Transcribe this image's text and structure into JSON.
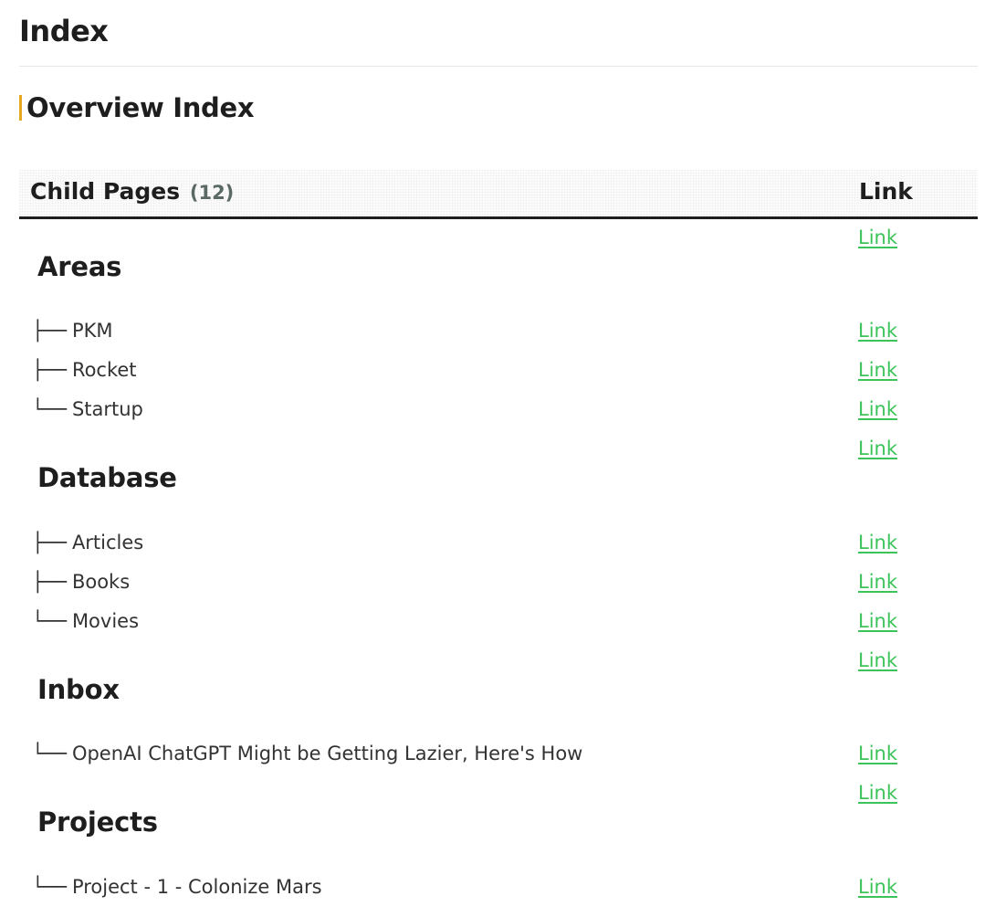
{
  "page": {
    "title": "Index"
  },
  "section": {
    "heading": "Overview Index",
    "accent_color": "#e5a820"
  },
  "table": {
    "col_pages_label": "Child Pages",
    "col_pages_count": "(12)",
    "col_link_label": "Link",
    "link_color": "#3cc35a",
    "rows": [
      {
        "kind": "group",
        "text": "Areas",
        "link": "Link"
      },
      {
        "kind": "item",
        "branch": "├──",
        "text": "PKM",
        "link": "Link"
      },
      {
        "kind": "item",
        "branch": "├──",
        "text": "Rocket",
        "link": "Link"
      },
      {
        "kind": "item",
        "branch": "└──",
        "text": "Startup",
        "link": "Link"
      },
      {
        "kind": "group",
        "text": "Database",
        "link": "Link"
      },
      {
        "kind": "item",
        "branch": "├──",
        "text": "Articles",
        "link": "Link"
      },
      {
        "kind": "item",
        "branch": "├──",
        "text": "Books",
        "link": "Link"
      },
      {
        "kind": "item",
        "branch": "└──",
        "text": "Movies",
        "link": "Link"
      },
      {
        "kind": "group",
        "text": "Inbox",
        "link": "Link"
      },
      {
        "kind": "item",
        "branch": "└──",
        "text": "OpenAI ChatGPT Might be Getting Lazier, Here's How",
        "link": "Link"
      },
      {
        "kind": "group",
        "text": "Projects",
        "link": "Link"
      },
      {
        "kind": "item",
        "branch": "└──",
        "text": "Project - 1 - Colonize Mars",
        "link": "Link"
      }
    ]
  }
}
